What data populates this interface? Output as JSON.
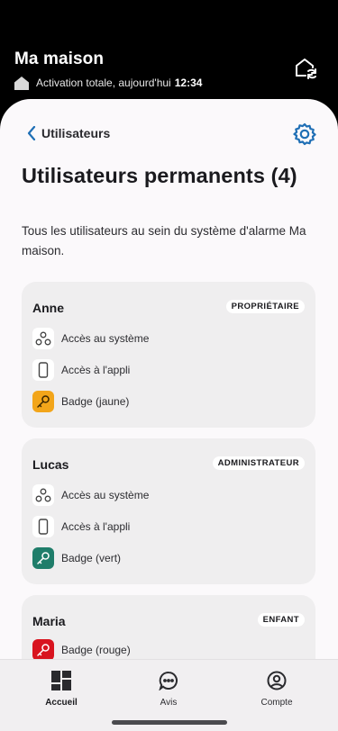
{
  "header": {
    "home_title": "Ma maison",
    "status_text": "Activation totale, aujourd'hui",
    "status_time": "12:34"
  },
  "nav": {
    "back_label": "Utilisateurs"
  },
  "page": {
    "title": "Utilisateurs permanents (4)",
    "description": "Tous les utilisateurs au sein du système d'alarme Ma maison."
  },
  "users": [
    {
      "name": "Anne",
      "role": "PROPRIÉTAIRE",
      "access": [
        {
          "label": "Accès au système",
          "icon": "system-icon"
        },
        {
          "label": "Accès à l'appli",
          "icon": "phone-icon"
        },
        {
          "label": "Badge (jaune)",
          "icon": "key-icon",
          "color": "#f2a51a"
        }
      ]
    },
    {
      "name": "Lucas",
      "role": "ADMINISTRATEUR",
      "access": [
        {
          "label": "Accès au système",
          "icon": "system-icon"
        },
        {
          "label": "Accès à l'appli",
          "icon": "phone-icon"
        },
        {
          "label": "Badge (vert)",
          "icon": "key-icon",
          "color": "#1f7d6a"
        }
      ]
    },
    {
      "name": "Maria",
      "role": "ENFANT",
      "access": [
        {
          "label": "Badge (rouge)",
          "icon": "key-icon",
          "color": "#d8141f"
        }
      ]
    }
  ],
  "tabs": [
    {
      "label": "Accueil",
      "icon": "dashboard-icon",
      "active": true
    },
    {
      "label": "Avis",
      "icon": "chat-icon",
      "active": false
    },
    {
      "label": "Compte",
      "icon": "account-icon",
      "active": false
    }
  ],
  "colors": {
    "accent": "#1f6fb5",
    "badge_yellow": "#f2a51a",
    "badge_green": "#1f7d6a",
    "badge_red": "#d8141f"
  }
}
